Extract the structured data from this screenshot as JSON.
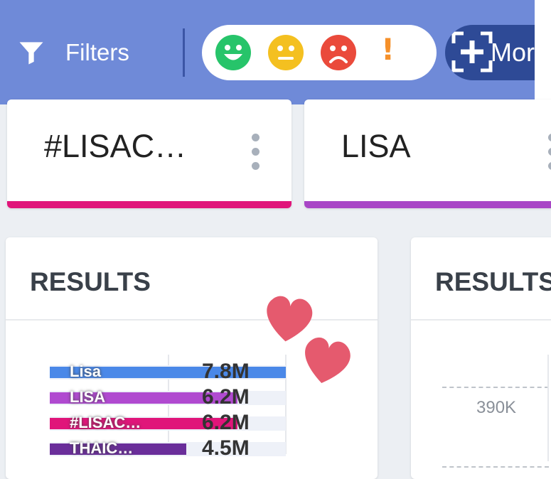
{
  "toolbar": {
    "filters_label": "Filters",
    "more_label": "More",
    "sentiments": [
      "happy-face",
      "neutral-face",
      "sad-face",
      "alert"
    ],
    "sentiment_colors": [
      "#27c46a",
      "#f4c020",
      "#ea4a3b",
      "#f5902a"
    ],
    "alert_glyph": "!"
  },
  "tags": [
    {
      "label": "#LISAC…",
      "color": "#e0157a"
    },
    {
      "label": "LISA",
      "color": "#a846c6"
    }
  ],
  "results": [
    {
      "title": "RESULTS",
      "rows": [
        {
          "label": "Lisa",
          "value": "7.8M",
          "fraction": 1.0,
          "color": "#4a88e8"
        },
        {
          "label": "LISA",
          "value": "6.2M",
          "fraction": 0.795,
          "color": "#b04ad0"
        },
        {
          "label": "#LISAC…",
          "value": "6.2M",
          "fraction": 0.795,
          "color": "#e0157a"
        },
        {
          "label": "THAIC…",
          "value": "4.5M",
          "fraction": 0.577,
          "color": "#6a2e9a"
        }
      ]
    },
    {
      "title": "RESULTS",
      "axis_label": "390K"
    }
  ],
  "decoration": {
    "heart_color": "#e55a6e"
  }
}
